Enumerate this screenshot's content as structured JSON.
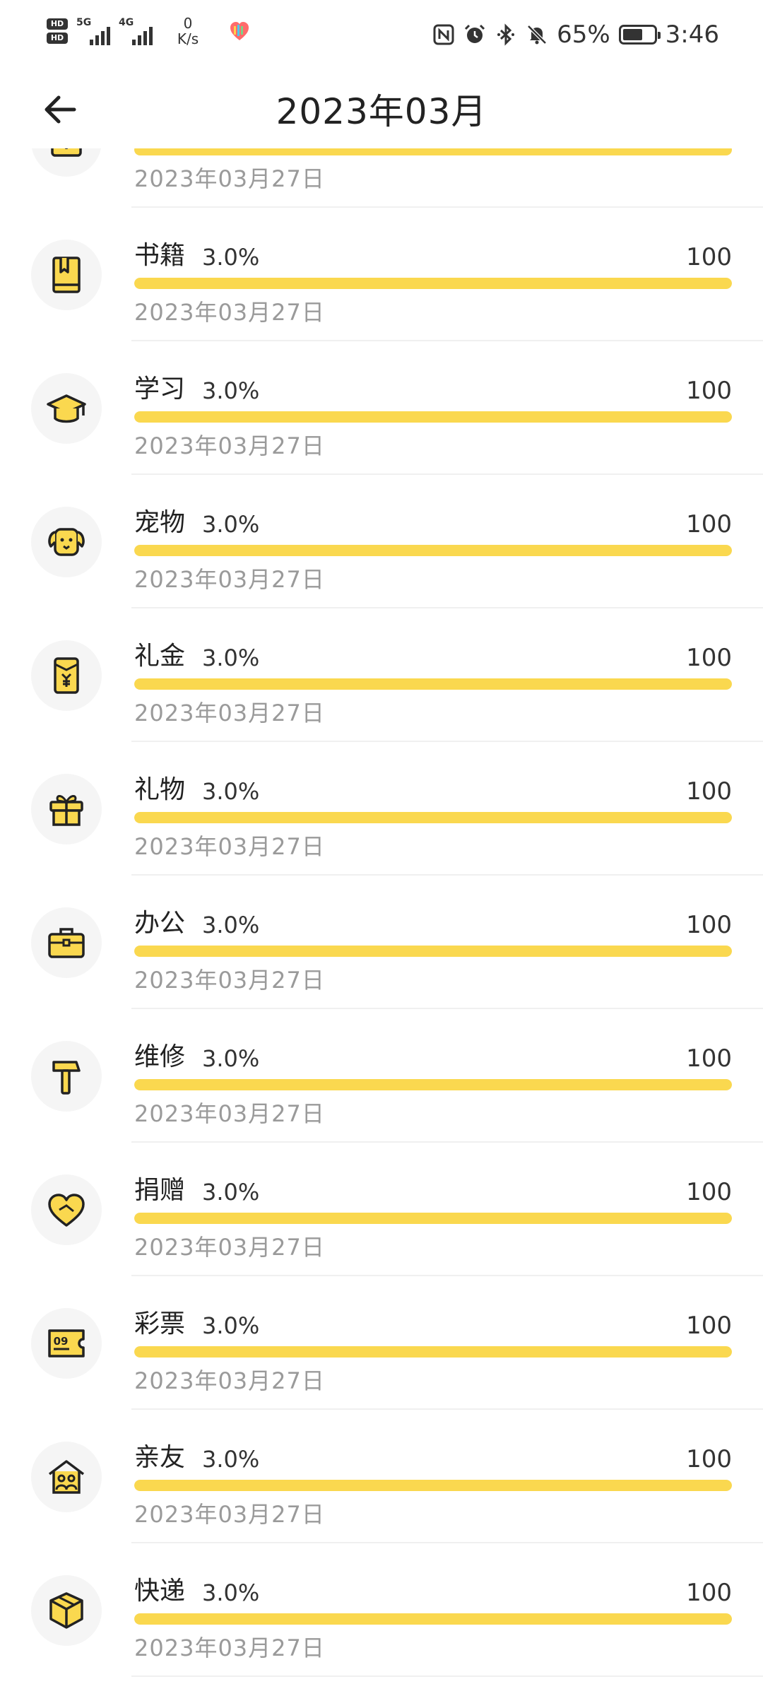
{
  "status_bar": {
    "hd_top": "HD",
    "hd_bottom": "HD",
    "sim1_type": "5G",
    "sim2_type": "4G",
    "net_speed_value": "0",
    "net_speed_unit": "K/s",
    "battery_percent": "65%",
    "battery_level": 0.65,
    "time": "3:46"
  },
  "header": {
    "title": "2023年03月"
  },
  "colors": {
    "accent": "#fad84f",
    "icon_fill": "#fad84f",
    "icon_stroke": "#222222",
    "icon_bg": "#f5f5f5",
    "text_secondary": "#9a9a9a"
  },
  "items": [
    {
      "name": "",
      "percent": "",
      "amount": "",
      "fill": 1.0,
      "date": "2023年03月27日",
      "icon": "medical-kit-icon"
    },
    {
      "name": "书籍",
      "percent": "3.0%",
      "amount": "100",
      "fill": 1.0,
      "date": "2023年03月27日",
      "icon": "book-icon"
    },
    {
      "name": "学习",
      "percent": "3.0%",
      "amount": "100",
      "fill": 1.0,
      "date": "2023年03月27日",
      "icon": "graduation-cap-icon"
    },
    {
      "name": "宠物",
      "percent": "3.0%",
      "amount": "100",
      "fill": 1.0,
      "date": "2023年03月27日",
      "icon": "dog-icon"
    },
    {
      "name": "礼金",
      "percent": "3.0%",
      "amount": "100",
      "fill": 1.0,
      "date": "2023年03月27日",
      "icon": "red-envelope-icon"
    },
    {
      "name": "礼物",
      "percent": "3.0%",
      "amount": "100",
      "fill": 1.0,
      "date": "2023年03月27日",
      "icon": "gift-icon"
    },
    {
      "name": "办公",
      "percent": "3.0%",
      "amount": "100",
      "fill": 1.0,
      "date": "2023年03月27日",
      "icon": "briefcase-icon"
    },
    {
      "name": "维修",
      "percent": "3.0%",
      "amount": "100",
      "fill": 1.0,
      "date": "2023年03月27日",
      "icon": "hammer-icon"
    },
    {
      "name": "捐赠",
      "percent": "3.0%",
      "amount": "100",
      "fill": 1.0,
      "date": "2023年03月27日",
      "icon": "heart-icon"
    },
    {
      "name": "彩票",
      "percent": "3.0%",
      "amount": "100",
      "fill": 1.0,
      "date": "2023年03月27日",
      "icon": "lottery-ticket-icon",
      "icon_text": "09"
    },
    {
      "name": "亲友",
      "percent": "3.0%",
      "amount": "100",
      "fill": 1.0,
      "date": "2023年03月27日",
      "icon": "family-house-icon"
    },
    {
      "name": "快递",
      "percent": "3.0%",
      "amount": "100",
      "fill": 1.0,
      "date": "2023年03月27日",
      "icon": "package-box-icon"
    }
  ]
}
